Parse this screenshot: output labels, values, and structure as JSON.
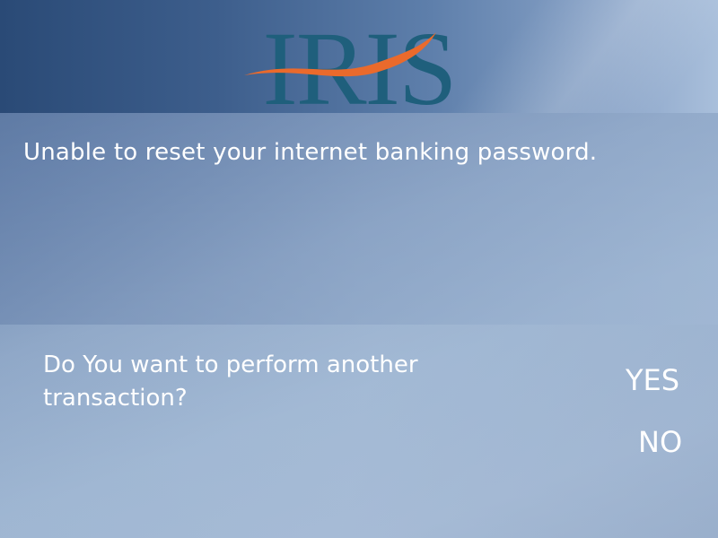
{
  "brand": {
    "logo_text": "IRIS",
    "colors": {
      "logo_letters": "#1f5f7c",
      "logo_swoosh": "#ea6a2c",
      "text": "#ffffff"
    }
  },
  "message": {
    "text": "Unable to reset your internet banking password."
  },
  "prompt": {
    "question": "Do You want to perform another transaction?"
  },
  "options": {
    "yes_label": "YES",
    "no_label": "NO"
  }
}
